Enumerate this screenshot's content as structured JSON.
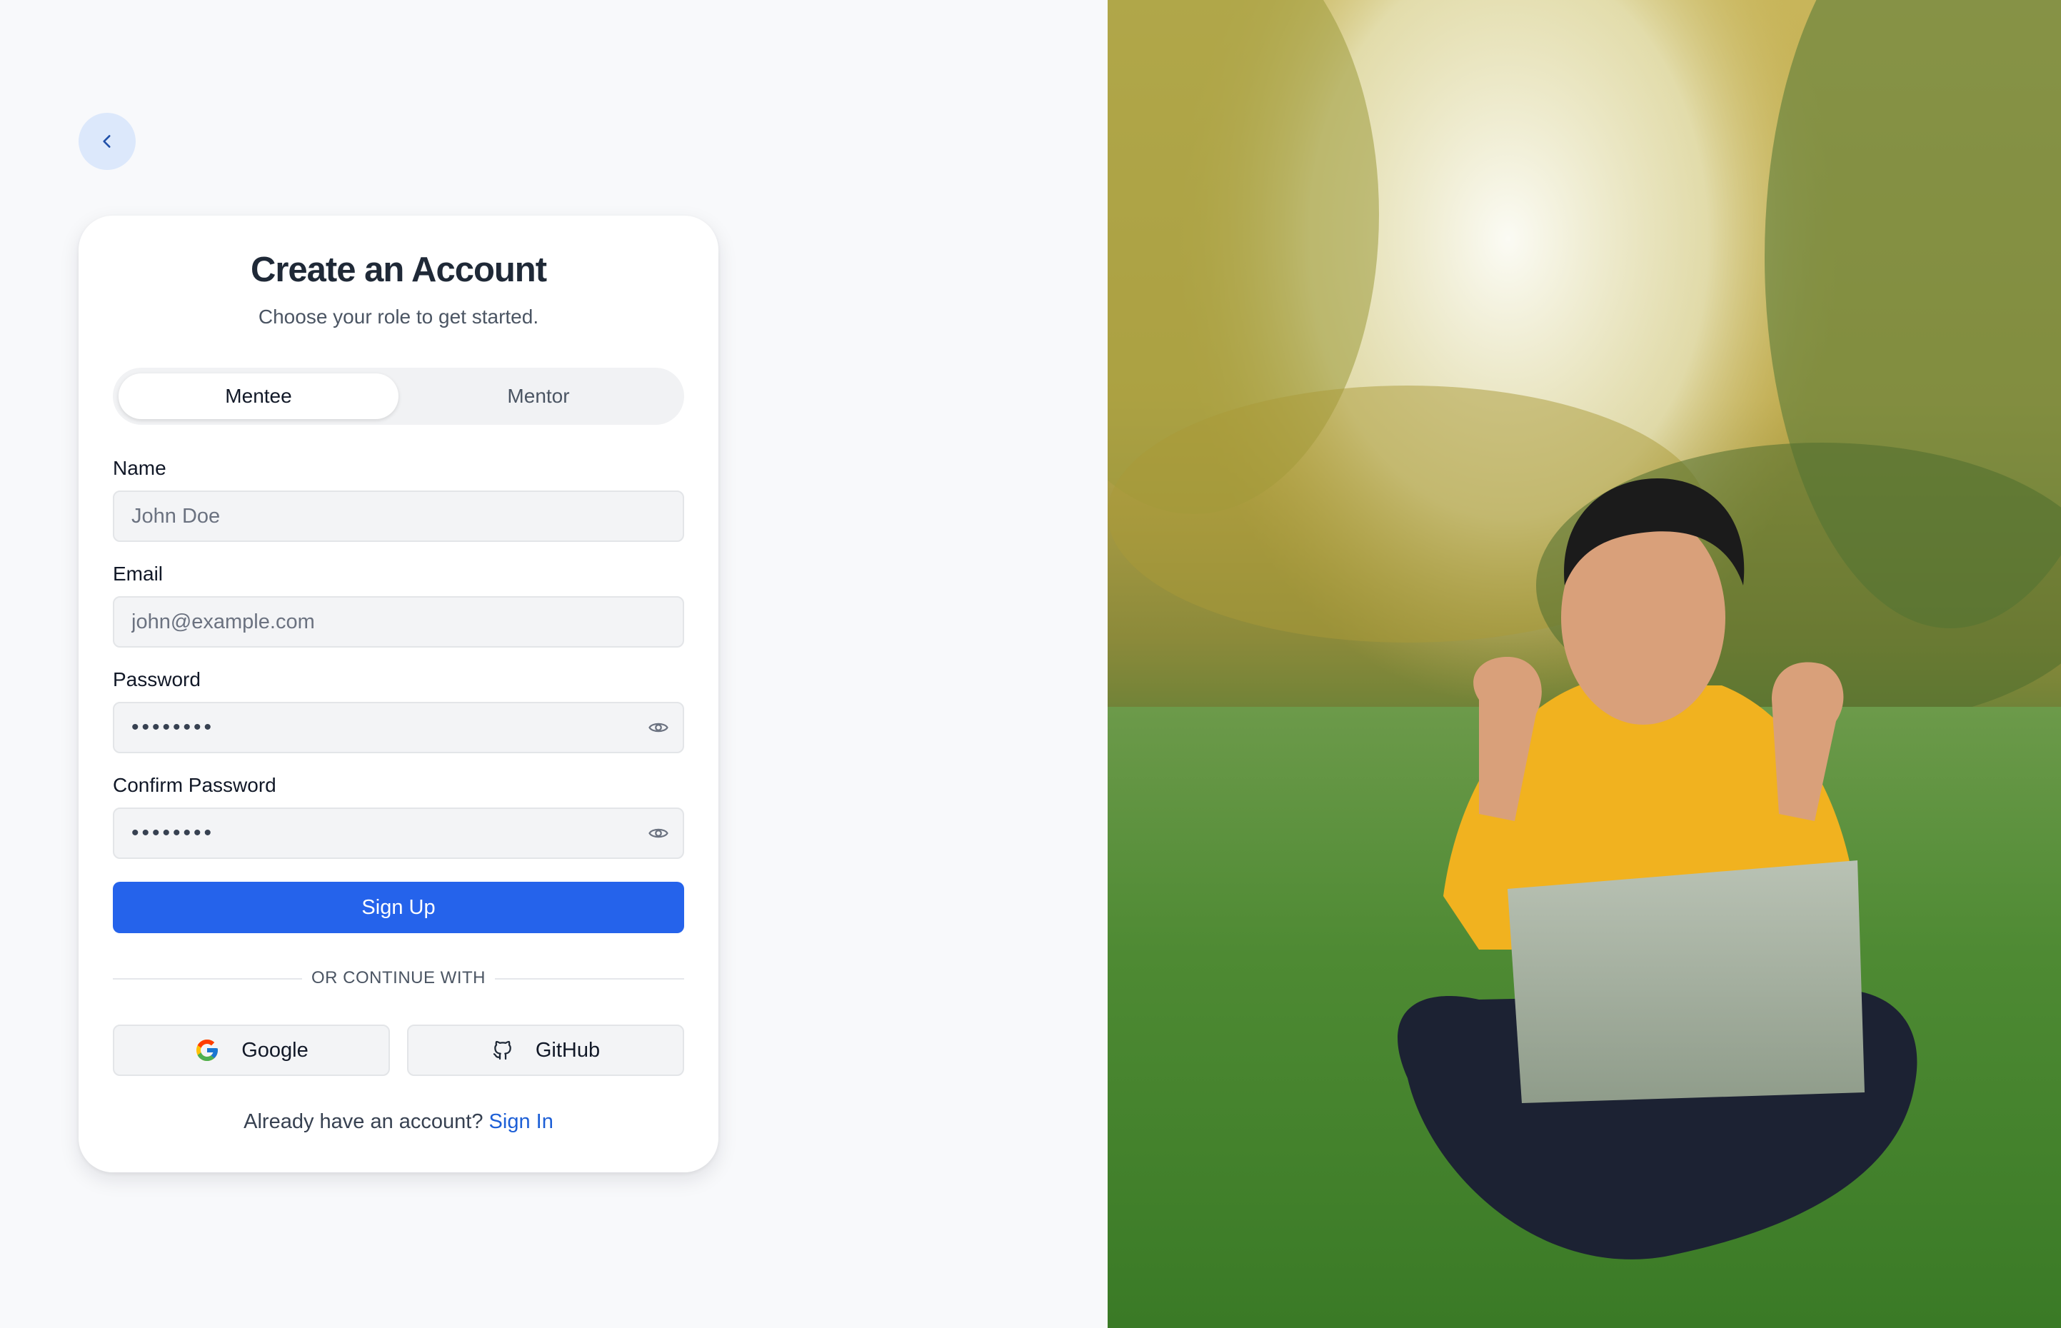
{
  "back_button": {
    "icon": "chevron-left-icon"
  },
  "card": {
    "title": "Create an Account",
    "subtitle": "Choose your role to get started."
  },
  "role_toggle": {
    "options": [
      "Mentee",
      "Mentor"
    ],
    "selected": "Mentee"
  },
  "form": {
    "name": {
      "label": "Name",
      "placeholder": "John Doe",
      "value": ""
    },
    "email": {
      "label": "Email",
      "placeholder": "john@example.com",
      "value": ""
    },
    "password": {
      "label": "Password",
      "masked_value": "••••••••",
      "toggle_icon": "eye-icon"
    },
    "confirm_password": {
      "label": "Confirm Password",
      "masked_value": "••••••••",
      "toggle_icon": "eye-icon"
    },
    "submit_label": "Sign Up"
  },
  "divider_text": "OR CONTINUE WITH",
  "oauth": [
    {
      "label": "Google",
      "icon": "google-icon"
    },
    {
      "label": "GitHub",
      "icon": "github-icon"
    }
  ],
  "footer": {
    "prompt": "Already have an account?",
    "link_label": "Sign In"
  },
  "colors": {
    "primary": "#2563eb",
    "link": "#1d5fd6",
    "page_background": "#f8f9fb"
  },
  "hero_image": {
    "description_icon": "hero-photo"
  }
}
